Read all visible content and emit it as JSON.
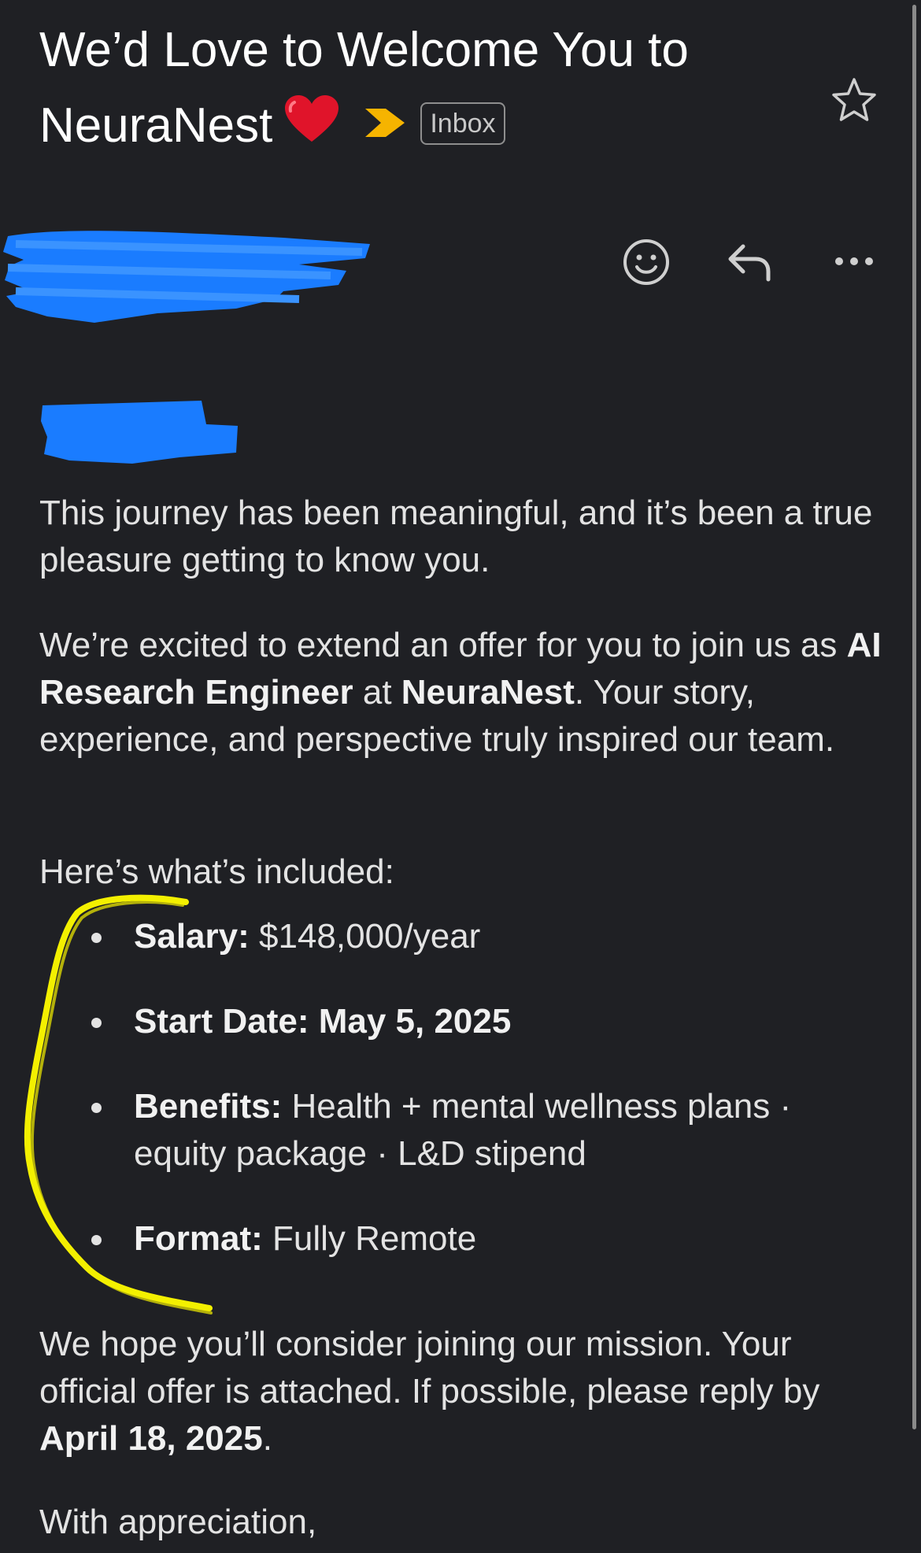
{
  "email": {
    "subject_line1": "We’d Love to Welcome You to",
    "subject_line2": "NeuraNest",
    "label_chip": "Inbox",
    "icons": {
      "heart": "red-heart-emoji-icon",
      "importance": "importance-marker-icon",
      "star": "star-icon",
      "react": "emoji-react-icon",
      "reply": "reply-icon",
      "more": "more-options-icon"
    },
    "colors": {
      "background": "#1f2024",
      "importance_marker": "#f6b400",
      "redaction": "#1a7cff",
      "highlight_annotation": "#f3f000"
    }
  },
  "message": {
    "p1": "This journey has been meaningful, and it’s been a true pleasure getting to know you.",
    "p2_pre": "We’re excited to extend an offer for you to join us as ",
    "p2_role": "AI Research Engineer",
    "p2_mid": " at ",
    "p2_company": "NeuraNest",
    "p2_post": ". Your story, experience, and perspective truly inspired our team.",
    "included_heading": "Here’s what’s included:",
    "items": [
      {
        "label": "Salary:",
        "value": " $148,000/year"
      },
      {
        "label": "Start Date: May 5, 2025",
        "value": ""
      },
      {
        "label": "Benefits:",
        "value": " Health + mental wellness plans · equity package · L&D stipend"
      },
      {
        "label": "Format:",
        "value": " Fully Remote"
      }
    ],
    "closing_pre": "We hope you’ll consider joining our mission. Your official offer is attached. If possible, please reply by ",
    "closing_date": "April 18, 2025",
    "closing_post": ".",
    "signoff": "With appreciation,"
  }
}
